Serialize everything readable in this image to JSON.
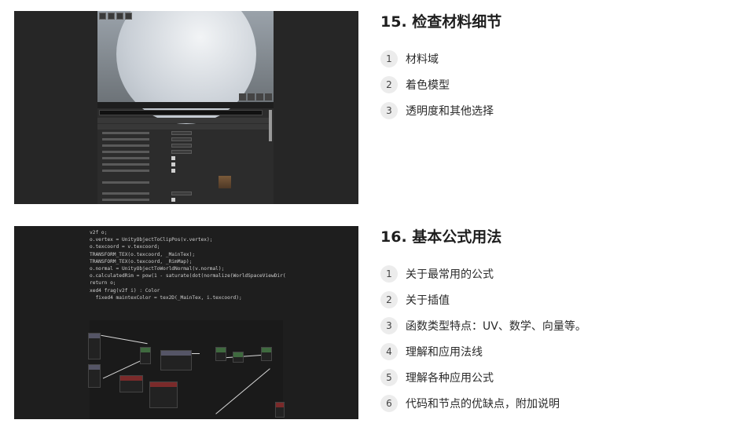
{
  "sections": [
    {
      "title": "15. 检查材料细节",
      "items": [
        {
          "num": "1",
          "label": "材料域"
        },
        {
          "num": "2",
          "label": "着色模型"
        },
        {
          "num": "3",
          "label": "透明度和其他选择"
        }
      ]
    },
    {
      "title": "16. 基本公式用法",
      "items": [
        {
          "num": "1",
          "label": "关于最常用的公式"
        },
        {
          "num": "2",
          "label": "关于插值"
        },
        {
          "num": "3",
          "label": "函数类型特点：UV、数学、向量等。"
        },
        {
          "num": "4",
          "label": "理解和应用法线"
        },
        {
          "num": "5",
          "label": "理解各种应用公式"
        },
        {
          "num": "6",
          "label": "代码和节点的优缺点，附加说明"
        }
      ]
    }
  ],
  "thumb2_code": [
    "v2f o;",
    "o.vertex = UnityObjectToClipPos(v.vertex);",
    "o.texcoord = v.texcoord;",
    "TRANSFORM_TEX(o.texcoord, _MainTex);",
    "TRANSFORM_TEX(o.texcoord, _RimMap);",
    "o.normal = UnityObjectToWorldNormal(v.normal);",
    "o.calculatedRim = pow(1 - saturate(dot(normalize(WorldSpaceViewDir(",
    "return o;",
    "",
    "xed4 frag(v2f i) : Color",
    "",
    "  fixed4 maintexColor = tex2D(_MainTex, i.texcoord);"
  ]
}
